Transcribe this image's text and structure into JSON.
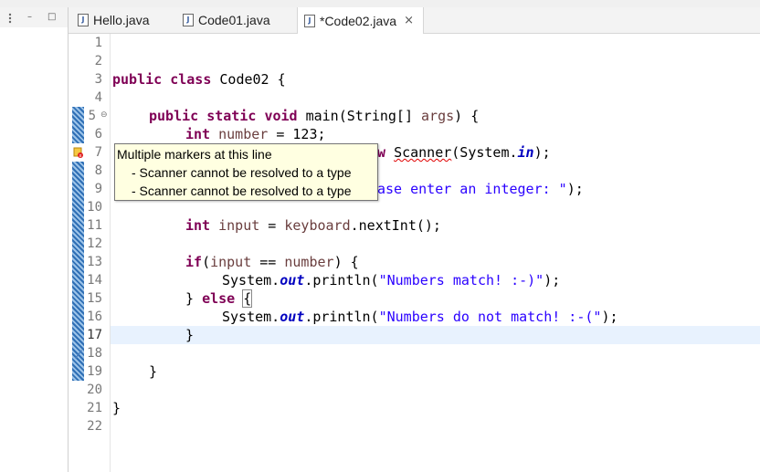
{
  "left_panel": {
    "minimize_icon": "–",
    "maximize_icon": "□"
  },
  "tabs": [
    {
      "label": "Hello.java",
      "icon": "java-file-icon"
    },
    {
      "label": "Code01.java",
      "icon": "java-file-icon"
    },
    {
      "label": "*Code02.java",
      "icon": "java-file-icon",
      "close": "×"
    }
  ],
  "editor": {
    "line_numbers": [
      "1",
      "2",
      "3",
      "4",
      "5",
      "6",
      "7",
      "8",
      "9",
      "10",
      "11",
      "12",
      "13",
      "14",
      "15",
      "16",
      "17",
      "18",
      "19",
      "20",
      "21",
      "22"
    ],
    "fold_marker": "⊖",
    "code": {
      "l3": {
        "kw1": "public",
        "kw2": "class",
        "rest": " Code02 {"
      },
      "l5": {
        "kw1": "public",
        "kw2": "static",
        "kw3": "void",
        "rest": " main(String[] ",
        "param": "args",
        "end": ") {"
      },
      "l6": {
        "kw": "int",
        "var": "number",
        "rest": " = 123;"
      },
      "l7": {
        "hidden_prefix": "w ",
        "class": "Scanner",
        "mid": "(System.",
        "field": "in",
        "end": ");"
      },
      "l9": {
        "str": "ase enter an integer: \"",
        "end": ");"
      },
      "l11": {
        "kw": "int",
        "var": "input",
        "eq": " = ",
        "var2": "keyboard",
        "rest": ".nextInt();"
      },
      "l13": {
        "kw": "if",
        "open": "(",
        "var": "input",
        "eq": " == ",
        "var2": "number",
        "end": ") {"
      },
      "l14": {
        "pre": "System.",
        "field": "out",
        "mid": ".println(",
        "str": "\"Numbers match! :-)\"",
        "end": ");"
      },
      "l15": {
        "pre": "} ",
        "kw": "else",
        "space": " ",
        "brace": "{"
      },
      "l16": {
        "pre": "System.",
        "field": "out",
        "mid": ".println(",
        "str": "\"Numbers do not match! :-(\"",
        "end": ");"
      },
      "l17": "}",
      "l19": "}",
      "l21": "}"
    }
  },
  "tooltip": {
    "title": "Multiple markers at this line",
    "items": [
      "- Scanner cannot be resolved to a type",
      "- Scanner cannot be resolved to a type"
    ]
  },
  "colors": {
    "keyword": "#7f0055",
    "string": "#2a00ff",
    "field": "#0000c0",
    "local_var": "#6a3e3e",
    "current_line": "#e8f2fe",
    "tooltip_bg": "#ffffe1"
  }
}
